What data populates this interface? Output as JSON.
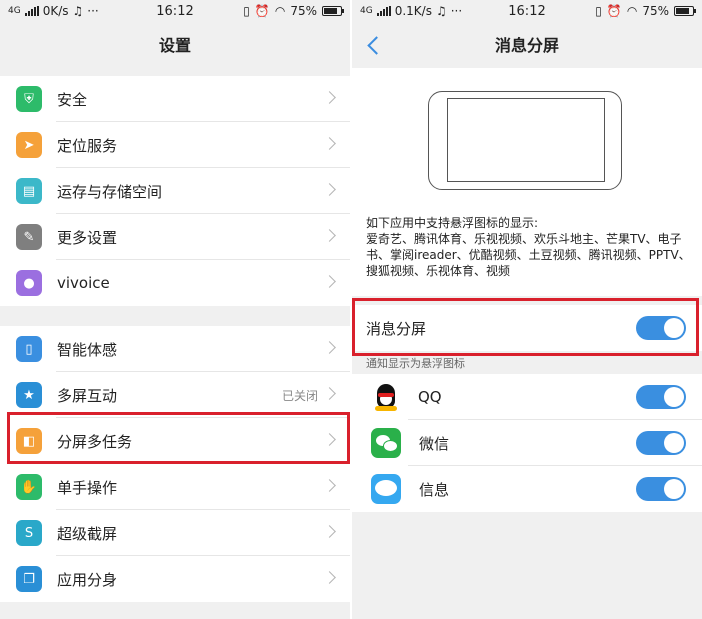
{
  "left": {
    "status": {
      "network": "4G",
      "speed": "0K/s",
      "time": "16:12",
      "battery": "75%"
    },
    "title": "设置",
    "group1": [
      {
        "label": "安全",
        "icon": "shield-icon",
        "color": "#2dbb6a",
        "glyph": "⛨"
      },
      {
        "label": "定位服务",
        "icon": "location-arrow-icon",
        "color": "#f5a13a",
        "glyph": "➤"
      },
      {
        "label": "运存与存储空间",
        "icon": "storage-icon",
        "color": "#3cb8c9",
        "glyph": "▤"
      },
      {
        "label": "更多设置",
        "icon": "wrench-icon",
        "color": "#7f7f7f",
        "glyph": "✎"
      },
      {
        "label": "vivoice",
        "icon": "microphone-icon",
        "color": "#9b6fe0",
        "glyph": "●"
      }
    ],
    "group2": [
      {
        "label": "智能体感",
        "icon": "motion-icon",
        "color": "#3a8fe0",
        "glyph": "▯",
        "value": ""
      },
      {
        "label": "多屏互动",
        "icon": "multiscreen-icon",
        "color": "#2a8fd6",
        "glyph": "★",
        "value": "已关闭"
      },
      {
        "label": "分屏多任务",
        "icon": "split-screen-icon",
        "color": "#f5a13a",
        "glyph": "◧",
        "value": ""
      },
      {
        "label": "单手操作",
        "icon": "one-hand-icon",
        "color": "#2dbb6a",
        "glyph": "✋",
        "value": ""
      },
      {
        "label": "超级截屏",
        "icon": "screenshot-icon",
        "color": "#2aa8c9",
        "glyph": "S",
        "value": ""
      },
      {
        "label": "应用分身",
        "icon": "app-clone-icon",
        "color": "#2a8fd6",
        "glyph": "❐",
        "value": ""
      }
    ]
  },
  "right": {
    "status": {
      "network": "4G",
      "speed": "0.1K/s",
      "time": "16:12",
      "battery": "75%"
    },
    "title": "消息分屏",
    "description": "如下应用中支持悬浮图标的显示:\n爱奇艺、腾讯体育、乐视视频、欢乐斗地主、芒果TV、电子书、掌阅ireader、优酷视频、土豆视频、腾讯视频、PPTV、搜狐视频、乐视体育、视频",
    "main_toggle": {
      "label": "消息分屏",
      "on": true
    },
    "note": "通知显示为悬浮图标",
    "apps": [
      {
        "label": "QQ",
        "icon": "qq-icon",
        "on": true
      },
      {
        "label": "微信",
        "icon": "wechat-icon",
        "on": true
      },
      {
        "label": "信息",
        "icon": "messages-icon",
        "on": true
      }
    ]
  },
  "colors": {
    "toggle_on": "#3a8fe0",
    "highlight": "#d9202c",
    "back_arrow": "#3b8de0"
  }
}
